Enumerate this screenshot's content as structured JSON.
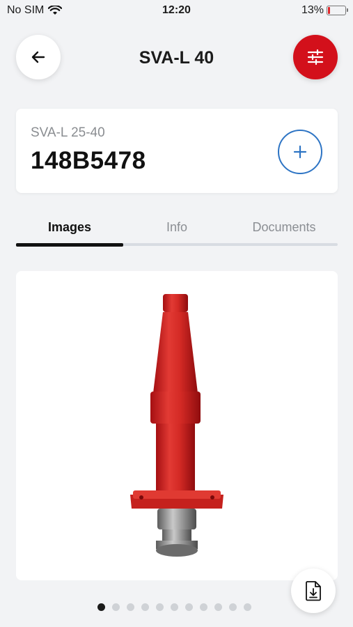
{
  "status_bar": {
    "carrier": "No SIM",
    "time": "12:20",
    "battery": "13%",
    "battery_level": 0.13,
    "battery_color": "#e0262a"
  },
  "header": {
    "title": "SVA-L 40",
    "back_icon": "arrow-left-icon",
    "filter_icon": "sliders-icon",
    "accent_color": "#d3101b"
  },
  "product": {
    "subtitle": "SVA-L 25-40",
    "code": "148B5478",
    "add_icon": "plus-icon",
    "add_color": "#2d74c4"
  },
  "tabs": [
    {
      "label": "Images",
      "active": true
    },
    {
      "label": "Info",
      "active": false
    },
    {
      "label": "Documents",
      "active": false
    }
  ],
  "gallery": {
    "image_icon": "valve-product-image",
    "page_count": 11,
    "current_page": 1,
    "download_icon": "file-download-icon"
  }
}
